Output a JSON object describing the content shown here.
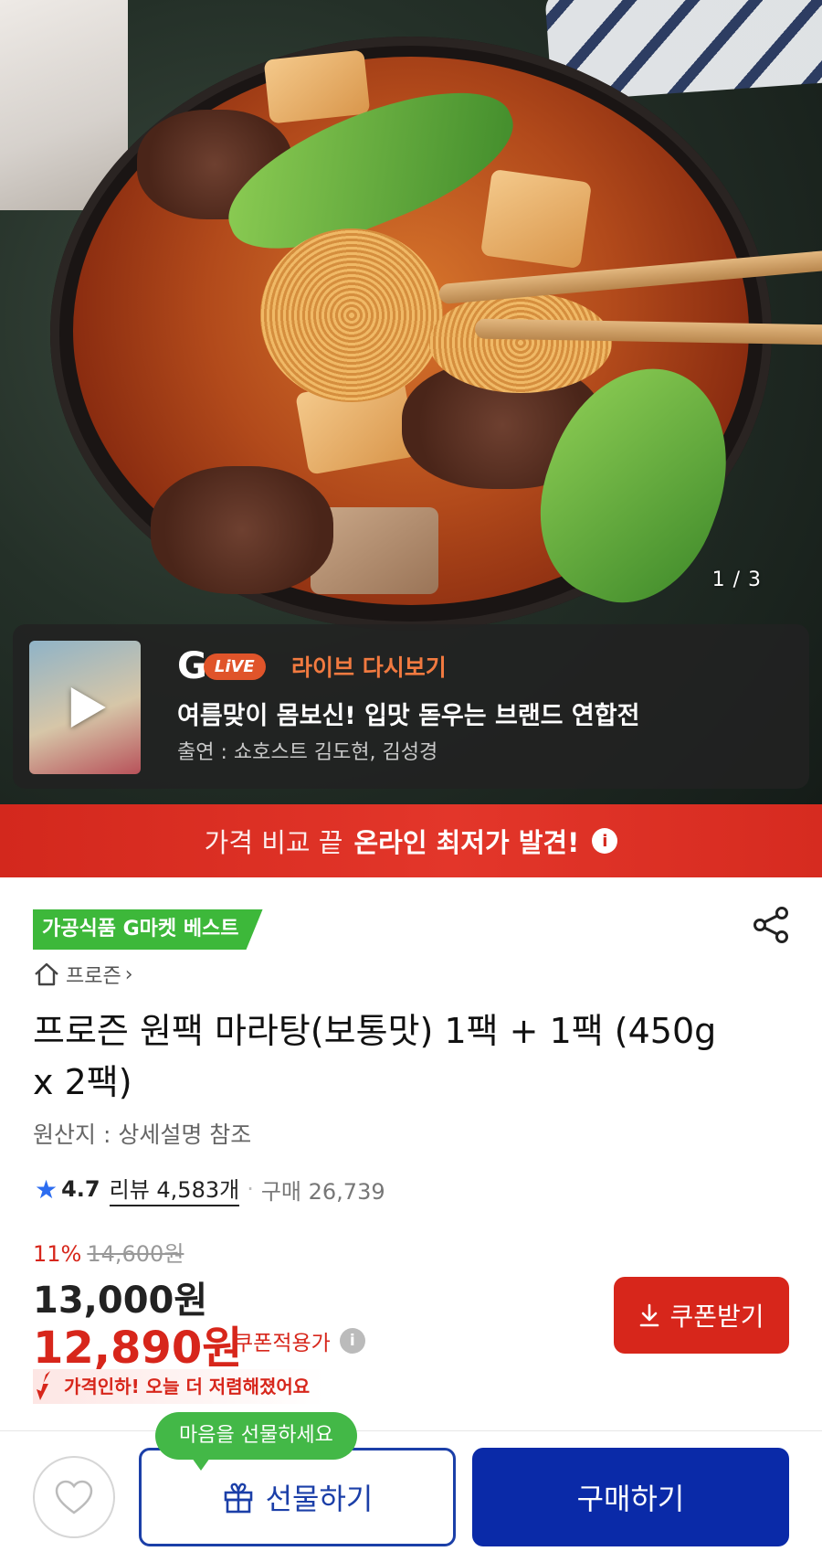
{
  "hero": {
    "counter": "1 / 3"
  },
  "live": {
    "logo_letter": "G",
    "logo_pill": "LiVE",
    "label": "라이브 다시보기",
    "title": "여름맞이 몸보신! 입맛 돋우는 브랜드 연합전",
    "cast": "출연 : 쇼호스트 김도현, 김성경"
  },
  "banner": {
    "normal_text": "가격 비교 끝",
    "bold_text": "온라인 최저가 발견!",
    "info_glyph": "i"
  },
  "product": {
    "badge": "가공식품 G마켓 베스트",
    "breadcrumb": "프로즌",
    "breadcrumb_chevron": "›",
    "title": "프로즌 원팩 마라탕(보통맛) 1팩 + 1팩 (450g x 2팩)",
    "origin": "원산지 : 상세설명 참조",
    "rating": "4.7",
    "review": "리뷰 4,583개",
    "separator": "·",
    "purchases": "구매 26,739",
    "discount_pct": "11%",
    "original_price": "14,600원",
    "sale_price": "13,000원",
    "coupon_price": "12,890원",
    "coupon_note": "쿠폰적용가",
    "coupon_button": "쿠폰받기",
    "drop_note": "가격인하! 오늘 더 저렴해졌어요"
  },
  "bottom": {
    "tooltip": "마음을 선물하세요",
    "gift_label": "선물하기",
    "buy_label": "구매하기"
  },
  "colors": {
    "accent_red": "#d7261b",
    "brand_blue": "#0a2aa8",
    "best_green": "#3db83a",
    "live_orange": "#f27a40"
  }
}
